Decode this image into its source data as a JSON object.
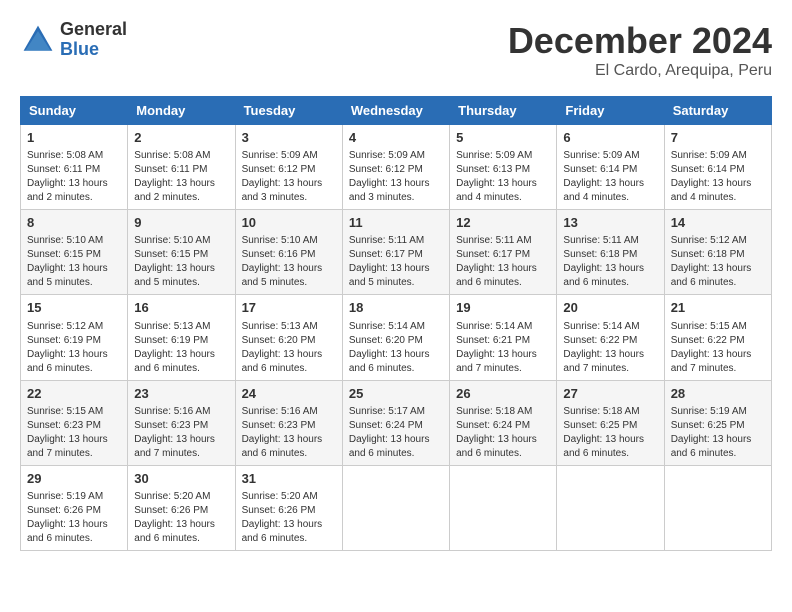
{
  "header": {
    "logo_general": "General",
    "logo_blue": "Blue",
    "month_title": "December 2024",
    "location": "El Cardo, Arequipa, Peru"
  },
  "days_of_week": [
    "Sunday",
    "Monday",
    "Tuesday",
    "Wednesday",
    "Thursday",
    "Friday",
    "Saturday"
  ],
  "weeks": [
    [
      {
        "day": "1",
        "info": "Sunrise: 5:08 AM\nSunset: 6:11 PM\nDaylight: 13 hours\nand 2 minutes."
      },
      {
        "day": "2",
        "info": "Sunrise: 5:08 AM\nSunset: 6:11 PM\nDaylight: 13 hours\nand 2 minutes."
      },
      {
        "day": "3",
        "info": "Sunrise: 5:09 AM\nSunset: 6:12 PM\nDaylight: 13 hours\nand 3 minutes."
      },
      {
        "day": "4",
        "info": "Sunrise: 5:09 AM\nSunset: 6:12 PM\nDaylight: 13 hours\nand 3 minutes."
      },
      {
        "day": "5",
        "info": "Sunrise: 5:09 AM\nSunset: 6:13 PM\nDaylight: 13 hours\nand 4 minutes."
      },
      {
        "day": "6",
        "info": "Sunrise: 5:09 AM\nSunset: 6:14 PM\nDaylight: 13 hours\nand 4 minutes."
      },
      {
        "day": "7",
        "info": "Sunrise: 5:09 AM\nSunset: 6:14 PM\nDaylight: 13 hours\nand 4 minutes."
      }
    ],
    [
      {
        "day": "8",
        "info": "Sunrise: 5:10 AM\nSunset: 6:15 PM\nDaylight: 13 hours\nand 5 minutes."
      },
      {
        "day": "9",
        "info": "Sunrise: 5:10 AM\nSunset: 6:15 PM\nDaylight: 13 hours\nand 5 minutes."
      },
      {
        "day": "10",
        "info": "Sunrise: 5:10 AM\nSunset: 6:16 PM\nDaylight: 13 hours\nand 5 minutes."
      },
      {
        "day": "11",
        "info": "Sunrise: 5:11 AM\nSunset: 6:17 PM\nDaylight: 13 hours\nand 5 minutes."
      },
      {
        "day": "12",
        "info": "Sunrise: 5:11 AM\nSunset: 6:17 PM\nDaylight: 13 hours\nand 6 minutes."
      },
      {
        "day": "13",
        "info": "Sunrise: 5:11 AM\nSunset: 6:18 PM\nDaylight: 13 hours\nand 6 minutes."
      },
      {
        "day": "14",
        "info": "Sunrise: 5:12 AM\nSunset: 6:18 PM\nDaylight: 13 hours\nand 6 minutes."
      }
    ],
    [
      {
        "day": "15",
        "info": "Sunrise: 5:12 AM\nSunset: 6:19 PM\nDaylight: 13 hours\nand 6 minutes."
      },
      {
        "day": "16",
        "info": "Sunrise: 5:13 AM\nSunset: 6:19 PM\nDaylight: 13 hours\nand 6 minutes."
      },
      {
        "day": "17",
        "info": "Sunrise: 5:13 AM\nSunset: 6:20 PM\nDaylight: 13 hours\nand 6 minutes."
      },
      {
        "day": "18",
        "info": "Sunrise: 5:14 AM\nSunset: 6:20 PM\nDaylight: 13 hours\nand 6 minutes."
      },
      {
        "day": "19",
        "info": "Sunrise: 5:14 AM\nSunset: 6:21 PM\nDaylight: 13 hours\nand 7 minutes."
      },
      {
        "day": "20",
        "info": "Sunrise: 5:14 AM\nSunset: 6:22 PM\nDaylight: 13 hours\nand 7 minutes."
      },
      {
        "day": "21",
        "info": "Sunrise: 5:15 AM\nSunset: 6:22 PM\nDaylight: 13 hours\nand 7 minutes."
      }
    ],
    [
      {
        "day": "22",
        "info": "Sunrise: 5:15 AM\nSunset: 6:23 PM\nDaylight: 13 hours\nand 7 minutes."
      },
      {
        "day": "23",
        "info": "Sunrise: 5:16 AM\nSunset: 6:23 PM\nDaylight: 13 hours\nand 7 minutes."
      },
      {
        "day": "24",
        "info": "Sunrise: 5:16 AM\nSunset: 6:23 PM\nDaylight: 13 hours\nand 6 minutes."
      },
      {
        "day": "25",
        "info": "Sunrise: 5:17 AM\nSunset: 6:24 PM\nDaylight: 13 hours\nand 6 minutes."
      },
      {
        "day": "26",
        "info": "Sunrise: 5:18 AM\nSunset: 6:24 PM\nDaylight: 13 hours\nand 6 minutes."
      },
      {
        "day": "27",
        "info": "Sunrise: 5:18 AM\nSunset: 6:25 PM\nDaylight: 13 hours\nand 6 minutes."
      },
      {
        "day": "28",
        "info": "Sunrise: 5:19 AM\nSunset: 6:25 PM\nDaylight: 13 hours\nand 6 minutes."
      }
    ],
    [
      {
        "day": "29",
        "info": "Sunrise: 5:19 AM\nSunset: 6:26 PM\nDaylight: 13 hours\nand 6 minutes."
      },
      {
        "day": "30",
        "info": "Sunrise: 5:20 AM\nSunset: 6:26 PM\nDaylight: 13 hours\nand 6 minutes."
      },
      {
        "day": "31",
        "info": "Sunrise: 5:20 AM\nSunset: 6:26 PM\nDaylight: 13 hours\nand 6 minutes."
      },
      {
        "day": "",
        "info": ""
      },
      {
        "day": "",
        "info": ""
      },
      {
        "day": "",
        "info": ""
      },
      {
        "day": "",
        "info": ""
      }
    ]
  ]
}
